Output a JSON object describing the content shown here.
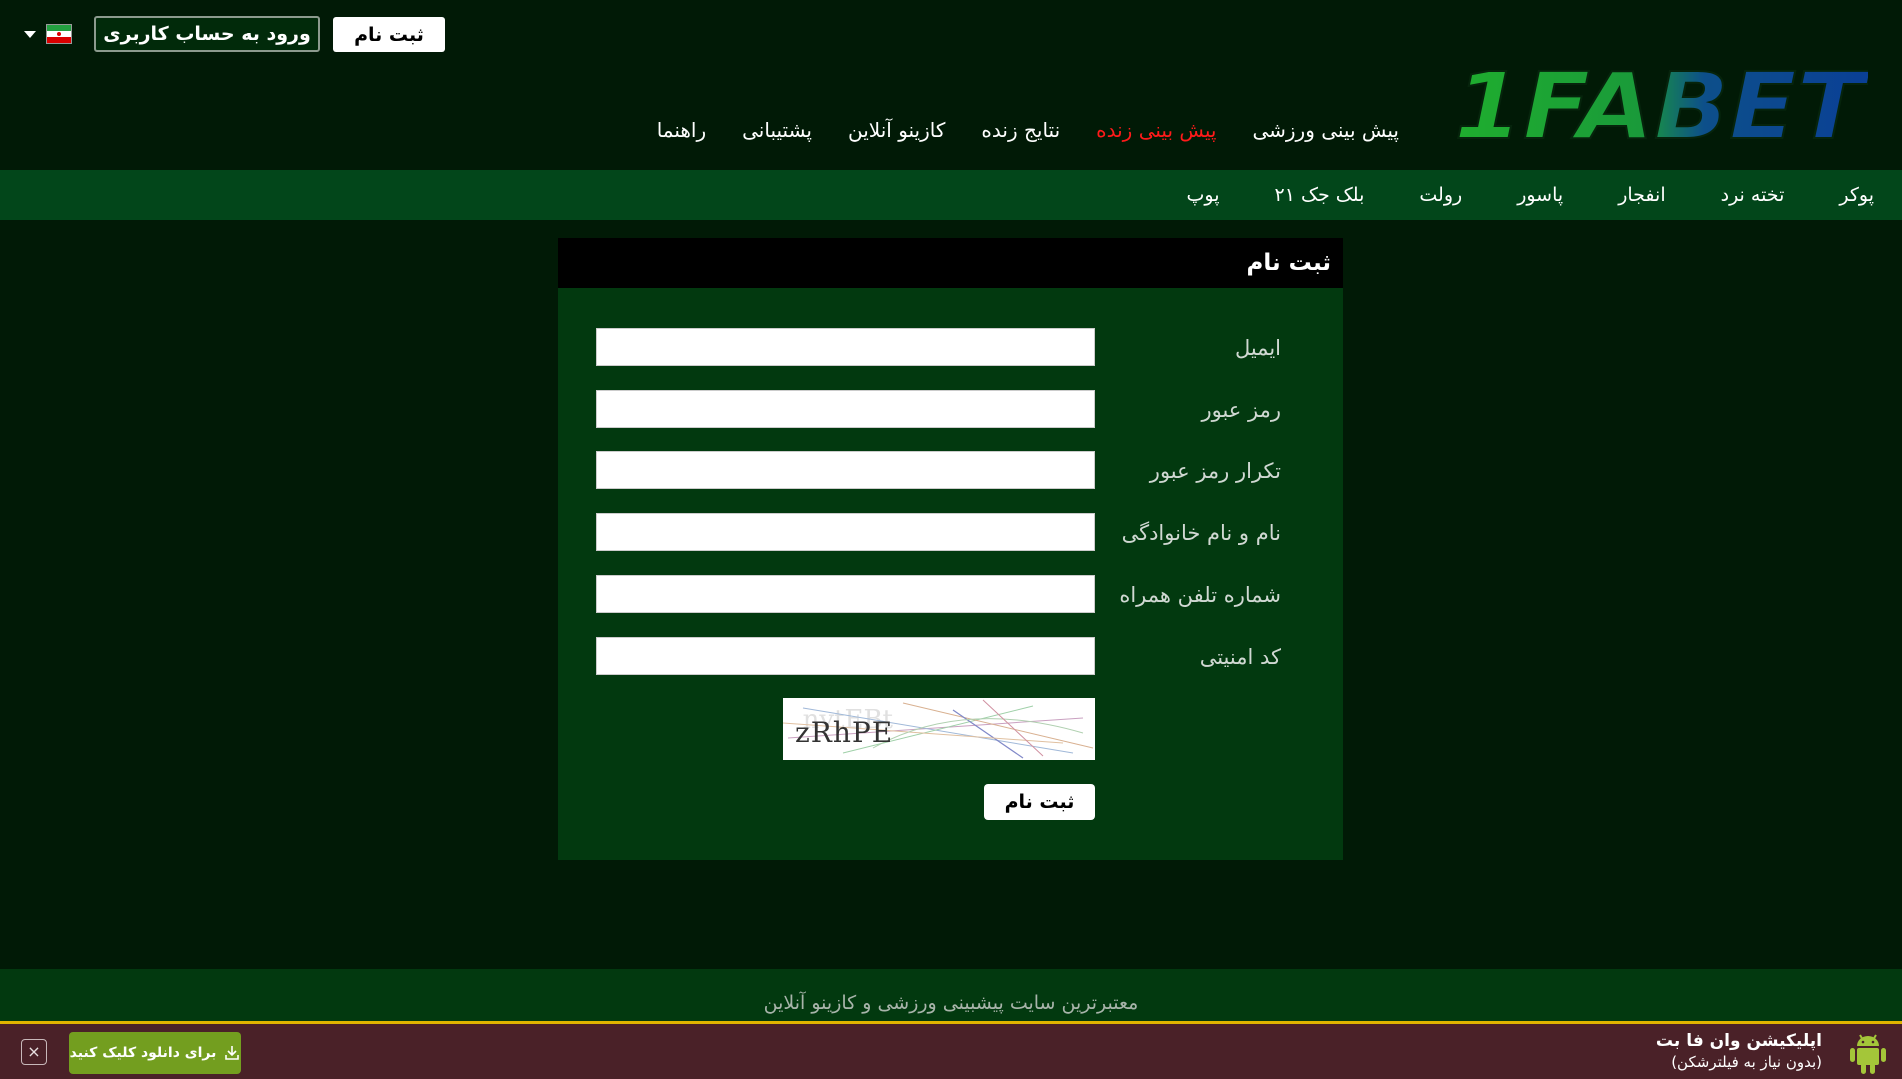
{
  "header": {
    "register_label": "ثبت نام",
    "login_label": "ورود به حساب کاربری",
    "language": "fa",
    "logo_text": "1FABET",
    "nav": [
      {
        "label": "پیش بینی ورزشی",
        "active": false
      },
      {
        "label": "پیش بینی زنده",
        "active": true
      },
      {
        "label": "نتایج زنده",
        "active": false
      },
      {
        "label": "کازینو آنلاین",
        "active": false
      },
      {
        "label": "پشتیبانی",
        "active": false
      },
      {
        "label": "راهنما",
        "active": false
      }
    ]
  },
  "subnav": {
    "items": [
      "پوکر",
      "تخته نرد",
      "انفجار",
      "پاسور",
      "رولت",
      "بلک جک ۲۱",
      "پوپ"
    ]
  },
  "form": {
    "title": "ثبت نام",
    "fields": [
      {
        "label": "ایمیل",
        "value": ""
      },
      {
        "label": "رمز عبور",
        "value": ""
      },
      {
        "label": "تکرار رمز عبور",
        "value": ""
      },
      {
        "label": "نام و نام خانوادگی",
        "value": ""
      },
      {
        "label": "شماره تلفن همراه",
        "value": ""
      },
      {
        "label": "کد امنیتی",
        "value": ""
      }
    ],
    "captcha_text": "zRhPE",
    "submit_label": "ثبت نام"
  },
  "footer": {
    "tagline": "معتبرترین سایت پیشبینی ورزشی و کازینو آنلاین"
  },
  "app_banner": {
    "title": "اپلیکیشن وان فا بت",
    "subtitle": "(بدون نیاز به فیلترشکن)",
    "download_label": "برای دانلود کلیک کنید",
    "close_symbol": "×"
  },
  "colors": {
    "background": "#011a06",
    "subnav": "#02461a",
    "panel": "#02390f",
    "active_nav": "#ff1a1a",
    "banner": "#4a2128",
    "banner_border": "#e0b400",
    "download_button": "#739e1f"
  }
}
